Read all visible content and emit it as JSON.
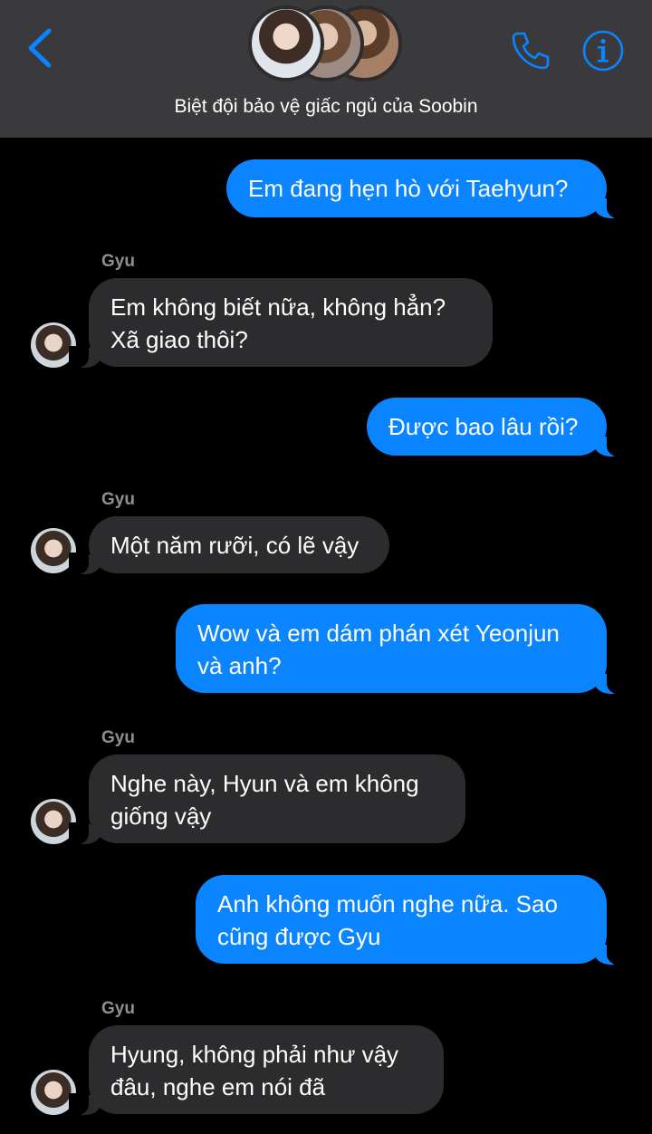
{
  "header": {
    "title": "Biệt đội bảo vệ giấc ngủ của Soobin",
    "back_icon": "chevron-left-icon",
    "phone_icon": "phone-icon",
    "info_icon": "info-icon",
    "accent": "#0a84ff"
  },
  "messages": [
    {
      "direction": "outgoing",
      "text": "Em đang hẹn hò với Taehyun?"
    },
    {
      "direction": "incoming",
      "sender": "Gyu",
      "lines": [
        "Em không biết nữa, không hẳn?",
        "Xã giao thôi?"
      ]
    },
    {
      "direction": "outgoing",
      "text": "Được bao lâu rồi?"
    },
    {
      "direction": "incoming",
      "sender": "Gyu",
      "lines": [
        "Một năm rưỡi, có lẽ vậy"
      ]
    },
    {
      "direction": "outgoing",
      "lines": [
        "Wow và em dám phán xét Yeonjun",
        "và anh?"
      ]
    },
    {
      "direction": "incoming",
      "sender": "Gyu",
      "lines": [
        "Nghe này, Hyun và em không",
        "giống vậy"
      ]
    },
    {
      "direction": "outgoing",
      "lines": [
        "Anh không muốn nghe nữa. Sao",
        "cũng được Gyu"
      ]
    },
    {
      "direction": "incoming",
      "sender": "Gyu",
      "lines": [
        "Hyung, không phải như vậy",
        "đâu, nghe em nói đã"
      ]
    }
  ]
}
